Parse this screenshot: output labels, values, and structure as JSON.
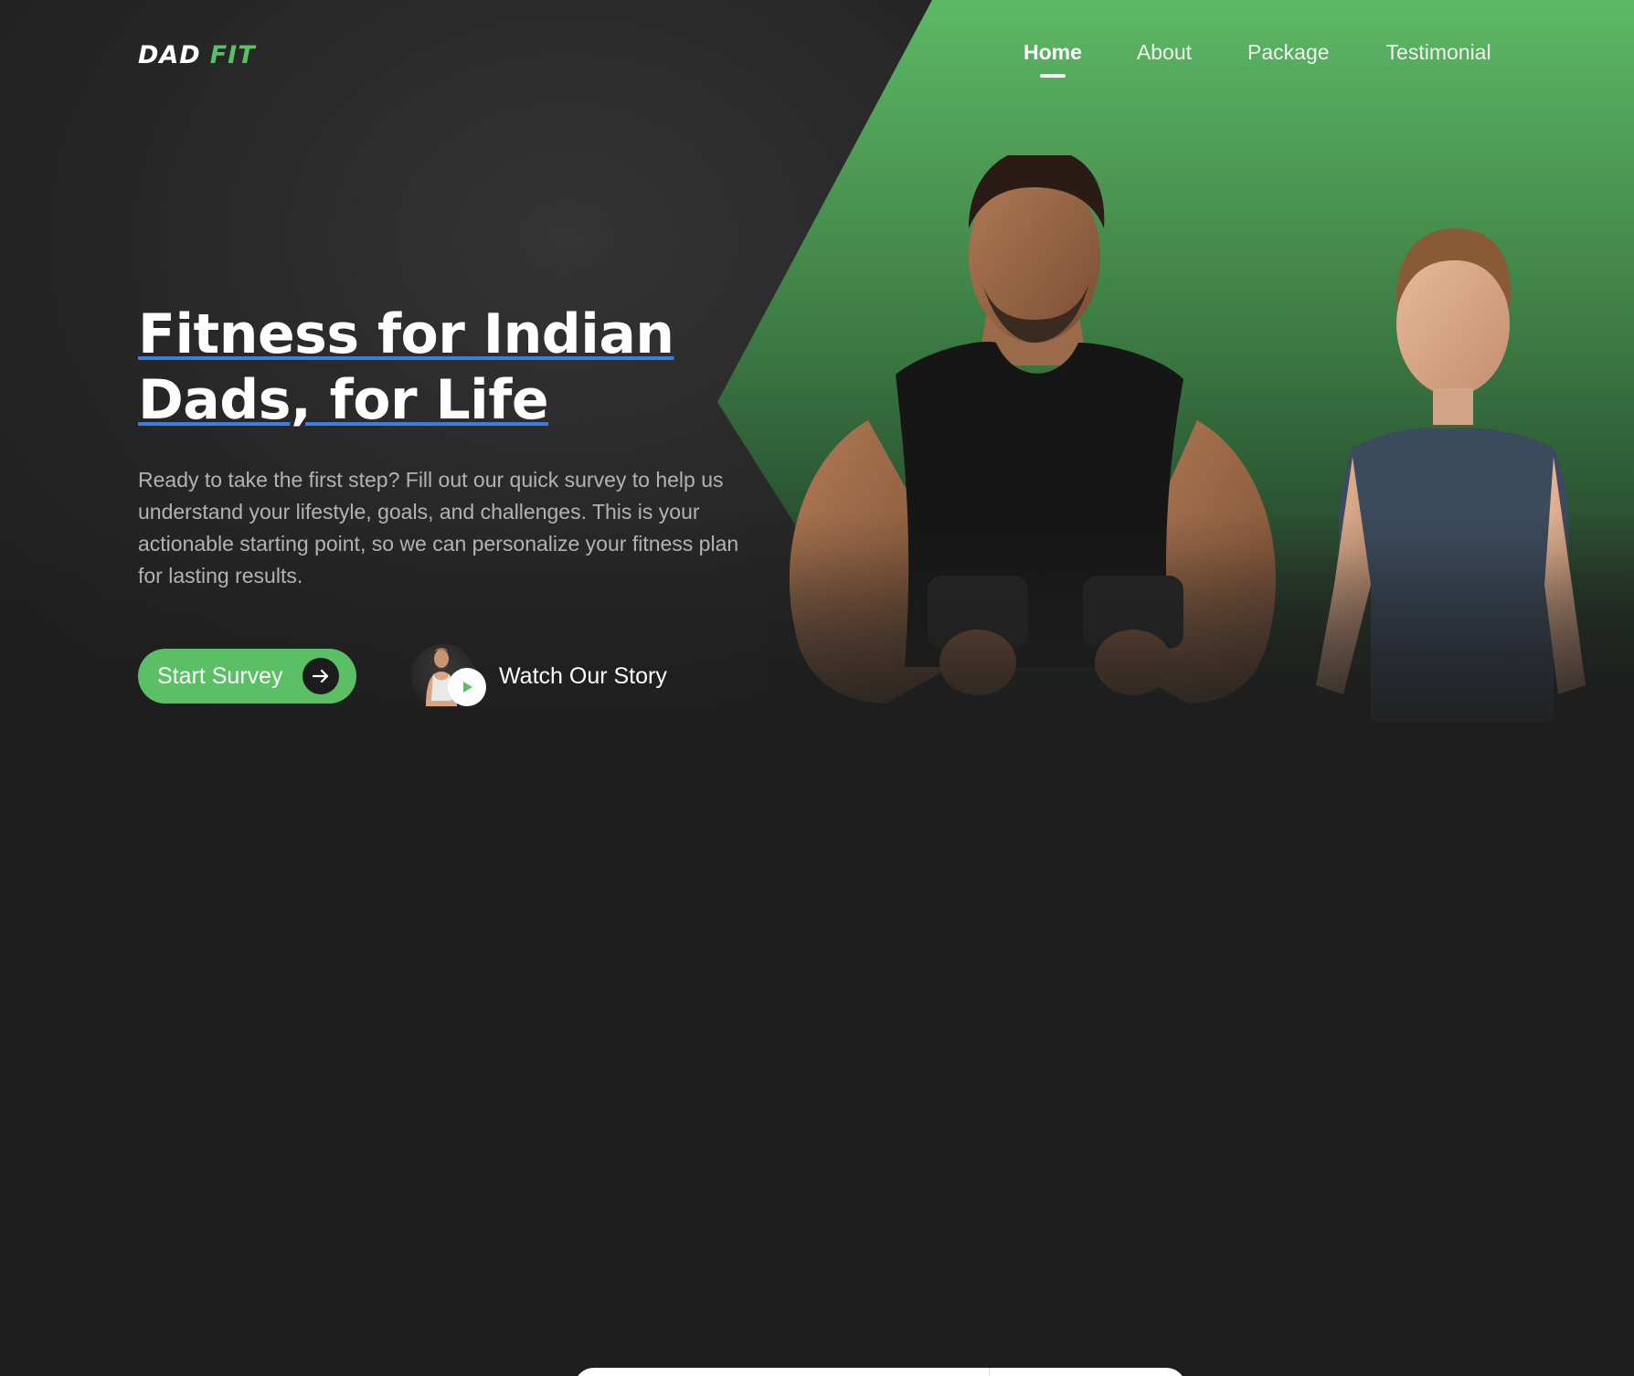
{
  "brand": {
    "logo_part1": "DAD",
    "logo_part2": "FIT",
    "accent_color": "#5bbf66",
    "underline_color": "#3b7de0"
  },
  "nav": {
    "items": [
      {
        "label": "Home",
        "active": true
      },
      {
        "label": "About",
        "active": false
      },
      {
        "label": "Package",
        "active": false
      },
      {
        "label": "Testimonial",
        "active": false
      }
    ]
  },
  "hero": {
    "title_line1": "Fitness for Indian",
    "title_line2": "Dads, for Life",
    "description": "Ready to take the first step? Fill out our quick survey to help us understand your lifestyle, goals, and challenges. This is your actionable starting point, so we can personalize your fitness plan for lasting results.",
    "primary_button": {
      "label": "Start Survey",
      "icon": "arrow-right-icon"
    },
    "secondary_button": {
      "label": "Watch Our Story",
      "icon": "play-icon"
    }
  }
}
